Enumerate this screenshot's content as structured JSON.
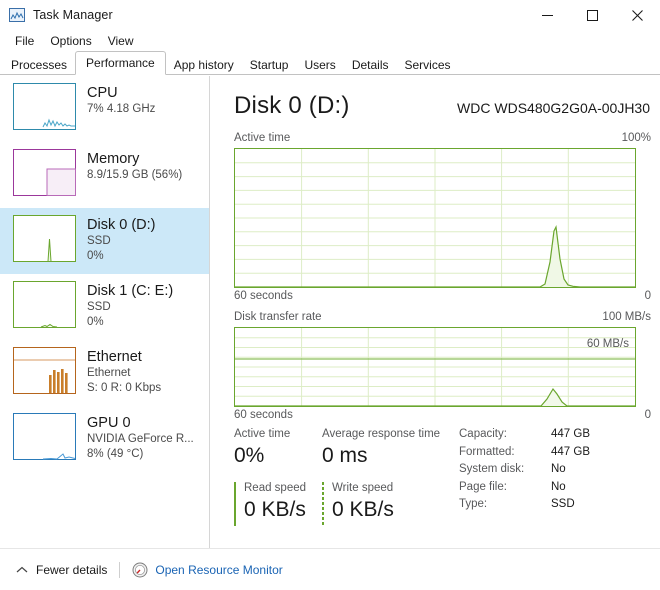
{
  "window": {
    "title": "Task Manager",
    "icon": "task-manager-icon",
    "minimize": "–",
    "maximize": "☐",
    "close": "✕"
  },
  "menu": {
    "items": [
      {
        "label": "File"
      },
      {
        "label": "Options"
      },
      {
        "label": "View"
      }
    ]
  },
  "tabs": {
    "active": "Performance",
    "items": [
      {
        "label": "Processes"
      },
      {
        "label": "Performance"
      },
      {
        "label": "App history"
      },
      {
        "label": "Startup"
      },
      {
        "label": "Users"
      },
      {
        "label": "Details"
      },
      {
        "label": "Services"
      }
    ]
  },
  "sidebar": {
    "items": [
      {
        "name": "CPU",
        "line2": "7%  4.18 GHz",
        "line3": "",
        "selected": false,
        "color": "#2e8aab",
        "graph": "cpu-thumbnail-graph"
      },
      {
        "name": "Memory",
        "line2": "8.9/15.9 GB (56%)",
        "line3": "",
        "selected": false,
        "color": "#9b379b",
        "graph": "memory-thumbnail-graph"
      },
      {
        "name": "Disk 0 (D:)",
        "line2": "SSD",
        "line3": "0%",
        "selected": true,
        "color": "#6aa62e",
        "graph": "disk0-thumbnail-graph"
      },
      {
        "name": "Disk 1 (C: E:)",
        "line2": "SSD",
        "line3": "0%",
        "selected": false,
        "color": "#6aa62e",
        "graph": "disk1-thumbnail-graph"
      },
      {
        "name": "Ethernet",
        "line2": "Ethernet",
        "line3": "S: 0 R: 0 Kbps",
        "selected": false,
        "color": "#b5651d",
        "graph": "ethernet-thumbnail-graph"
      },
      {
        "name": "GPU 0",
        "line2": "NVIDIA GeForce R...",
        "line3": "8%  (49 °C)",
        "selected": false,
        "color": "#2a7ab8",
        "graph": "gpu-thumbnail-graph"
      }
    ]
  },
  "main": {
    "title": "Disk 0 (D:)",
    "model": "WDC WDS480G2G0A-00JH30",
    "active_graph": {
      "caption": "Active time",
      "max_label": "100%",
      "left_axis": "60 seconds",
      "right_axis": "0"
    },
    "transfer_graph": {
      "caption": "Disk transfer rate",
      "max_label": "100 MB/s",
      "scale_label": "60 MB/s",
      "left_axis": "60 seconds",
      "right_axis": "0"
    },
    "readouts": [
      {
        "caption": "Active time",
        "value": "0%"
      },
      {
        "caption": "Average response time",
        "value": "0 ms"
      },
      {
        "caption": "Read speed",
        "value": "0 KB/s"
      },
      {
        "caption": "Write speed",
        "value": "0 KB/s"
      }
    ],
    "info": [
      {
        "key": "Capacity:",
        "value": "447 GB"
      },
      {
        "key": "Formatted:",
        "value": "447 GB"
      },
      {
        "key": "System disk:",
        "value": "No"
      },
      {
        "key": "Page file:",
        "value": "No"
      },
      {
        "key": "Type:",
        "value": "SSD"
      }
    ]
  },
  "status": {
    "fewer_details": "Fewer details",
    "resource_monitor": "Open Resource Monitor"
  },
  "chart_data": [
    {
      "type": "area",
      "title": "Active time",
      "ylabel": "Active time",
      "xlabel": "60 seconds",
      "ylim": [
        0,
        100
      ],
      "ymax_label": "100%",
      "xlim": [
        60,
        0
      ],
      "grid": true,
      "grid_rows": 10,
      "grid_cols": 6,
      "line_color": "#6aa62e",
      "fill_color": "#eef7e4",
      "x": [
        0,
        10,
        20,
        30,
        40,
        46,
        47,
        48,
        49,
        50,
        51,
        52,
        53,
        54,
        60
      ],
      "values": [
        0,
        0,
        0,
        0,
        0,
        0,
        0,
        2,
        18,
        40,
        22,
        6,
        2,
        0,
        0
      ]
    },
    {
      "type": "area",
      "title": "Disk transfer rate",
      "ylabel": "Disk transfer rate",
      "xlabel": "60 seconds",
      "ylim": [
        0,
        100
      ],
      "ymax_label": "100 MB/s",
      "scale_line_label": "60 MB/s",
      "scale_line_value": 60,
      "xlim": [
        60,
        0
      ],
      "grid": true,
      "grid_rows": 8,
      "grid_cols": 6,
      "line_color": "#6aa62e",
      "fill_color": "#f2f9ea",
      "x": [
        0,
        20,
        40,
        46,
        47,
        48,
        49,
        50,
        51,
        52,
        60
      ],
      "values": [
        0,
        0,
        0,
        0,
        2,
        8,
        16,
        9,
        3,
        0,
        0
      ]
    }
  ]
}
